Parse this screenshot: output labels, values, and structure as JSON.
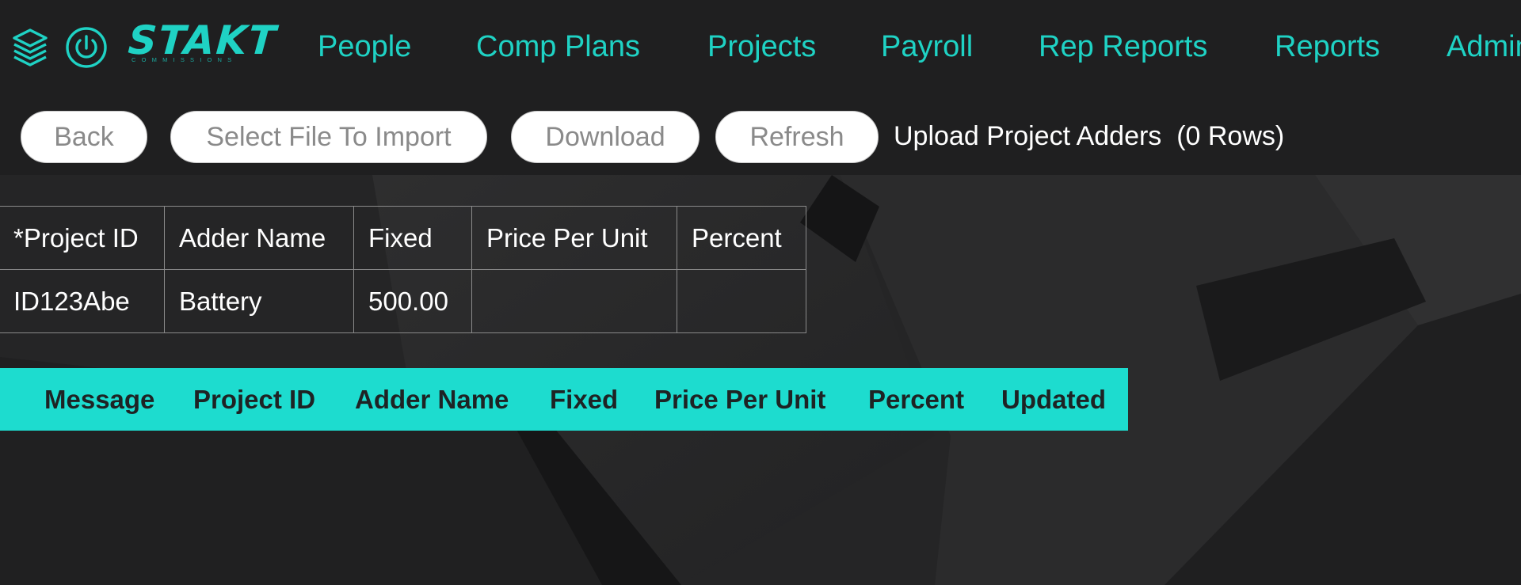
{
  "brand": {
    "name": "STAKT",
    "trademark": "™",
    "tagline": "COMMISSIONS",
    "accent_color": "#1fd2c4"
  },
  "nav": {
    "items": [
      {
        "id": "people",
        "label": "People"
      },
      {
        "id": "comp-plans",
        "label": "Comp Plans"
      },
      {
        "id": "projects",
        "label": "Projects"
      },
      {
        "id": "payroll",
        "label": "Payroll"
      },
      {
        "id": "rep-reports",
        "label": "Rep Reports"
      },
      {
        "id": "reports",
        "label": "Reports"
      },
      {
        "id": "admin",
        "label": "Admin"
      }
    ]
  },
  "toolbar": {
    "back_label": "Back",
    "select_file_label": "Select File To Import",
    "download_label": "Download",
    "refresh_label": "Refresh",
    "upload_title": "Upload Project Adders  (0 Rows)"
  },
  "import_table": {
    "headers": [
      "*Project ID",
      "Adder Name",
      "Fixed",
      "Price Per Unit",
      "Percent"
    ],
    "rows": [
      [
        "ID123Abe",
        "Battery",
        "500.00",
        "",
        ""
      ]
    ]
  },
  "results_header": {
    "columns": [
      "Message",
      "Project ID",
      "Adder Name",
      "Fixed",
      "Price Per Unit",
      "Percent",
      "Updated"
    ],
    "background_color": "#1ddccf"
  },
  "icons": [
    "stack-layers-icon",
    "power-icon"
  ]
}
